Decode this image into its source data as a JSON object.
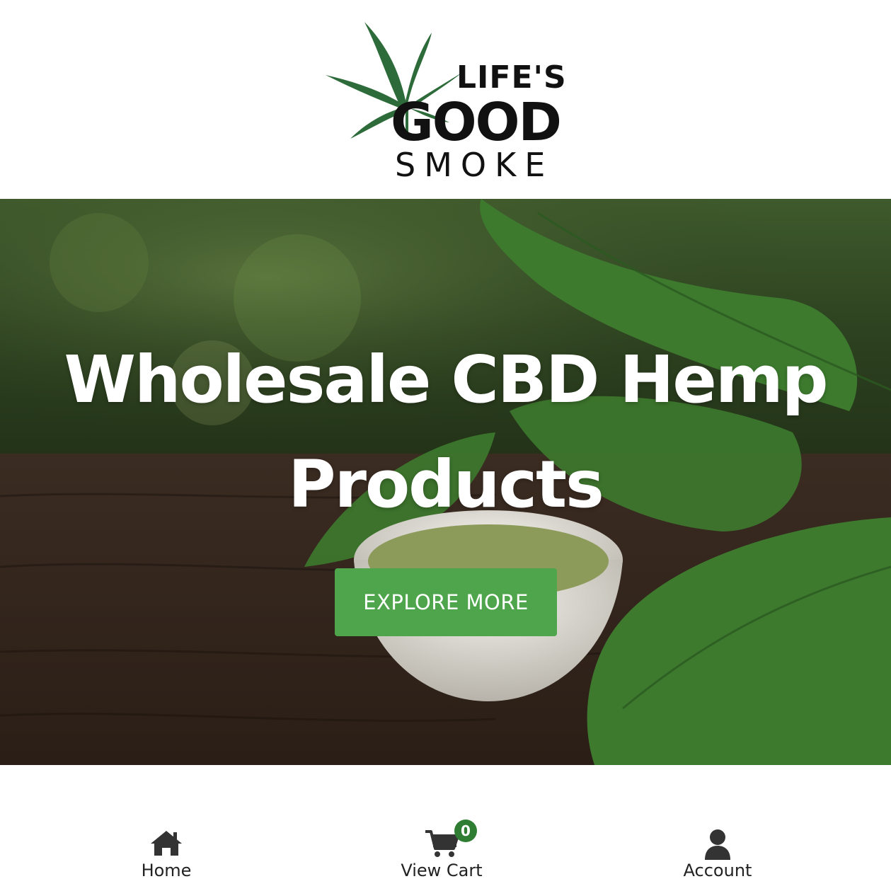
{
  "brand": {
    "logo_line1": "LIFE'S",
    "logo_line2": "GOOD",
    "logo_line3": "SMOKE",
    "leaf_color": "#2e6b3a"
  },
  "hero": {
    "title": "Wholesale CBD Hemp Products",
    "cta_label": "EXPLORE MORE",
    "cta_color": "#4ea54b"
  },
  "bottom_nav": {
    "items": [
      {
        "label": "Home",
        "icon": "home-icon"
      },
      {
        "label": "View Cart",
        "icon": "cart-icon",
        "badge": "0"
      },
      {
        "label": "Account",
        "icon": "user-icon"
      }
    ],
    "badge_color": "#2e7d32"
  }
}
